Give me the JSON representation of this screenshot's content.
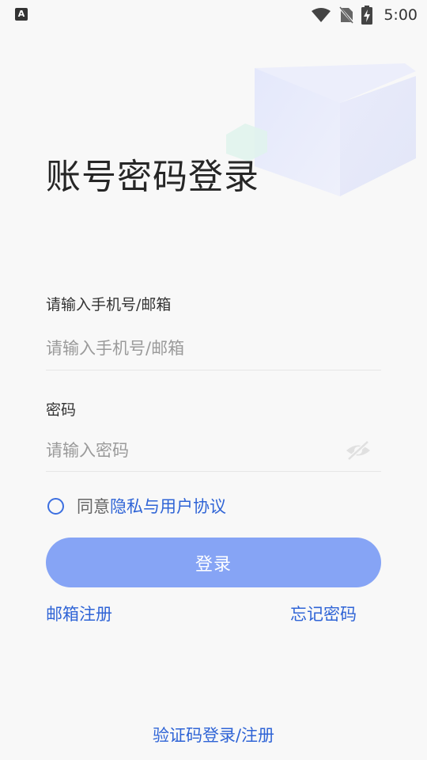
{
  "status_bar": {
    "app_icon_letter": "A",
    "time": "5:00"
  },
  "title": "账号密码登录",
  "account": {
    "label": "请输入手机号/邮箱",
    "placeholder": "请输入手机号/邮箱"
  },
  "password": {
    "label": "密码",
    "placeholder": "请输入密码"
  },
  "agreement": {
    "prefix": "同意",
    "link": "隐私与用户协议"
  },
  "login_button": "登录",
  "links": {
    "register": "邮箱注册",
    "forgot": "忘记密码",
    "code_login": "验证码登录/注册"
  },
  "colors": {
    "accent": "#2f64d6",
    "button": "#86a4f5",
    "background": "#f8f8f8"
  }
}
